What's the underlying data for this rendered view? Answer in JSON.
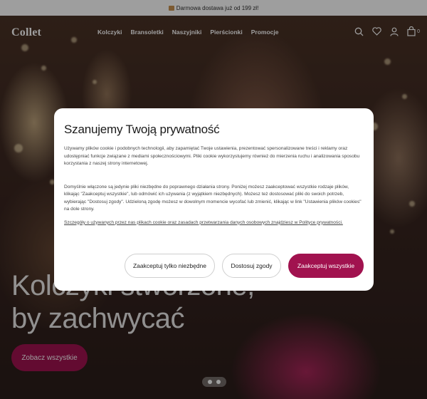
{
  "promo_bar": {
    "text": "Darmowa dostawa już od 199 zł!",
    "icon": "package-icon"
  },
  "header": {
    "logo": "Collet",
    "nav": [
      "Kolczyki",
      "Bransoletki",
      "Naszyjniki",
      "Pierścionki",
      "Promocje"
    ],
    "cart_count": "0",
    "icons": [
      "search-icon",
      "heart-icon",
      "user-icon",
      "bag-icon"
    ]
  },
  "hero": {
    "title_line1": "Kolczyki stworzone,",
    "title_line2": "by zachwycać",
    "cta": "Zobacz wszystkie"
  },
  "cookie_modal": {
    "title": "Szanujemy Twoją prywatność",
    "paragraph1": "Używamy plików cookie i podobnych technologii, aby zapamiętać Twoje ustawienia, prezentować spersonalizowane treści i reklamy oraz udostępniać funkcje związane z mediami społecznościowymi. Pliki cookie wykorzystujemy również do mierzenia ruchu i analizowania sposobu korzystania z naszej strony internetowej.",
    "paragraph2": "Domyślnie włączone są jedynie pliki niezbędne do poprawnego działania strony. Poniżej możesz zaakceptować wszystkie rodzaje plików, klikając \"Zaakceptuj wszystkie\", lub odmówić ich używania (z wyjątkiem niezbędnych). Możesz też dostosować pliki do swoich potrzeb, wybierając \"Dostosuj zgody\". Udzieloną zgodę możesz w dowolnym momencie wycofać lub zmienić, klikając w link \"Ustawienia plików cookies\" na dole strony.",
    "details_link": "Szczegóły o używanych przez nas plikach cookie oraz zasadach przetwarzania danych osobowych znajdziesz w Polityce prywatności.",
    "buttons": {
      "necessary": "Zaakceptuj tylko niezbędne",
      "customize": "Dostosuj zgody",
      "accept_all": "Zaakceptuj wszystkie"
    }
  },
  "colors": {
    "accent": "#a1124f",
    "overlay": "rgba(0,0,0,0.38)"
  }
}
